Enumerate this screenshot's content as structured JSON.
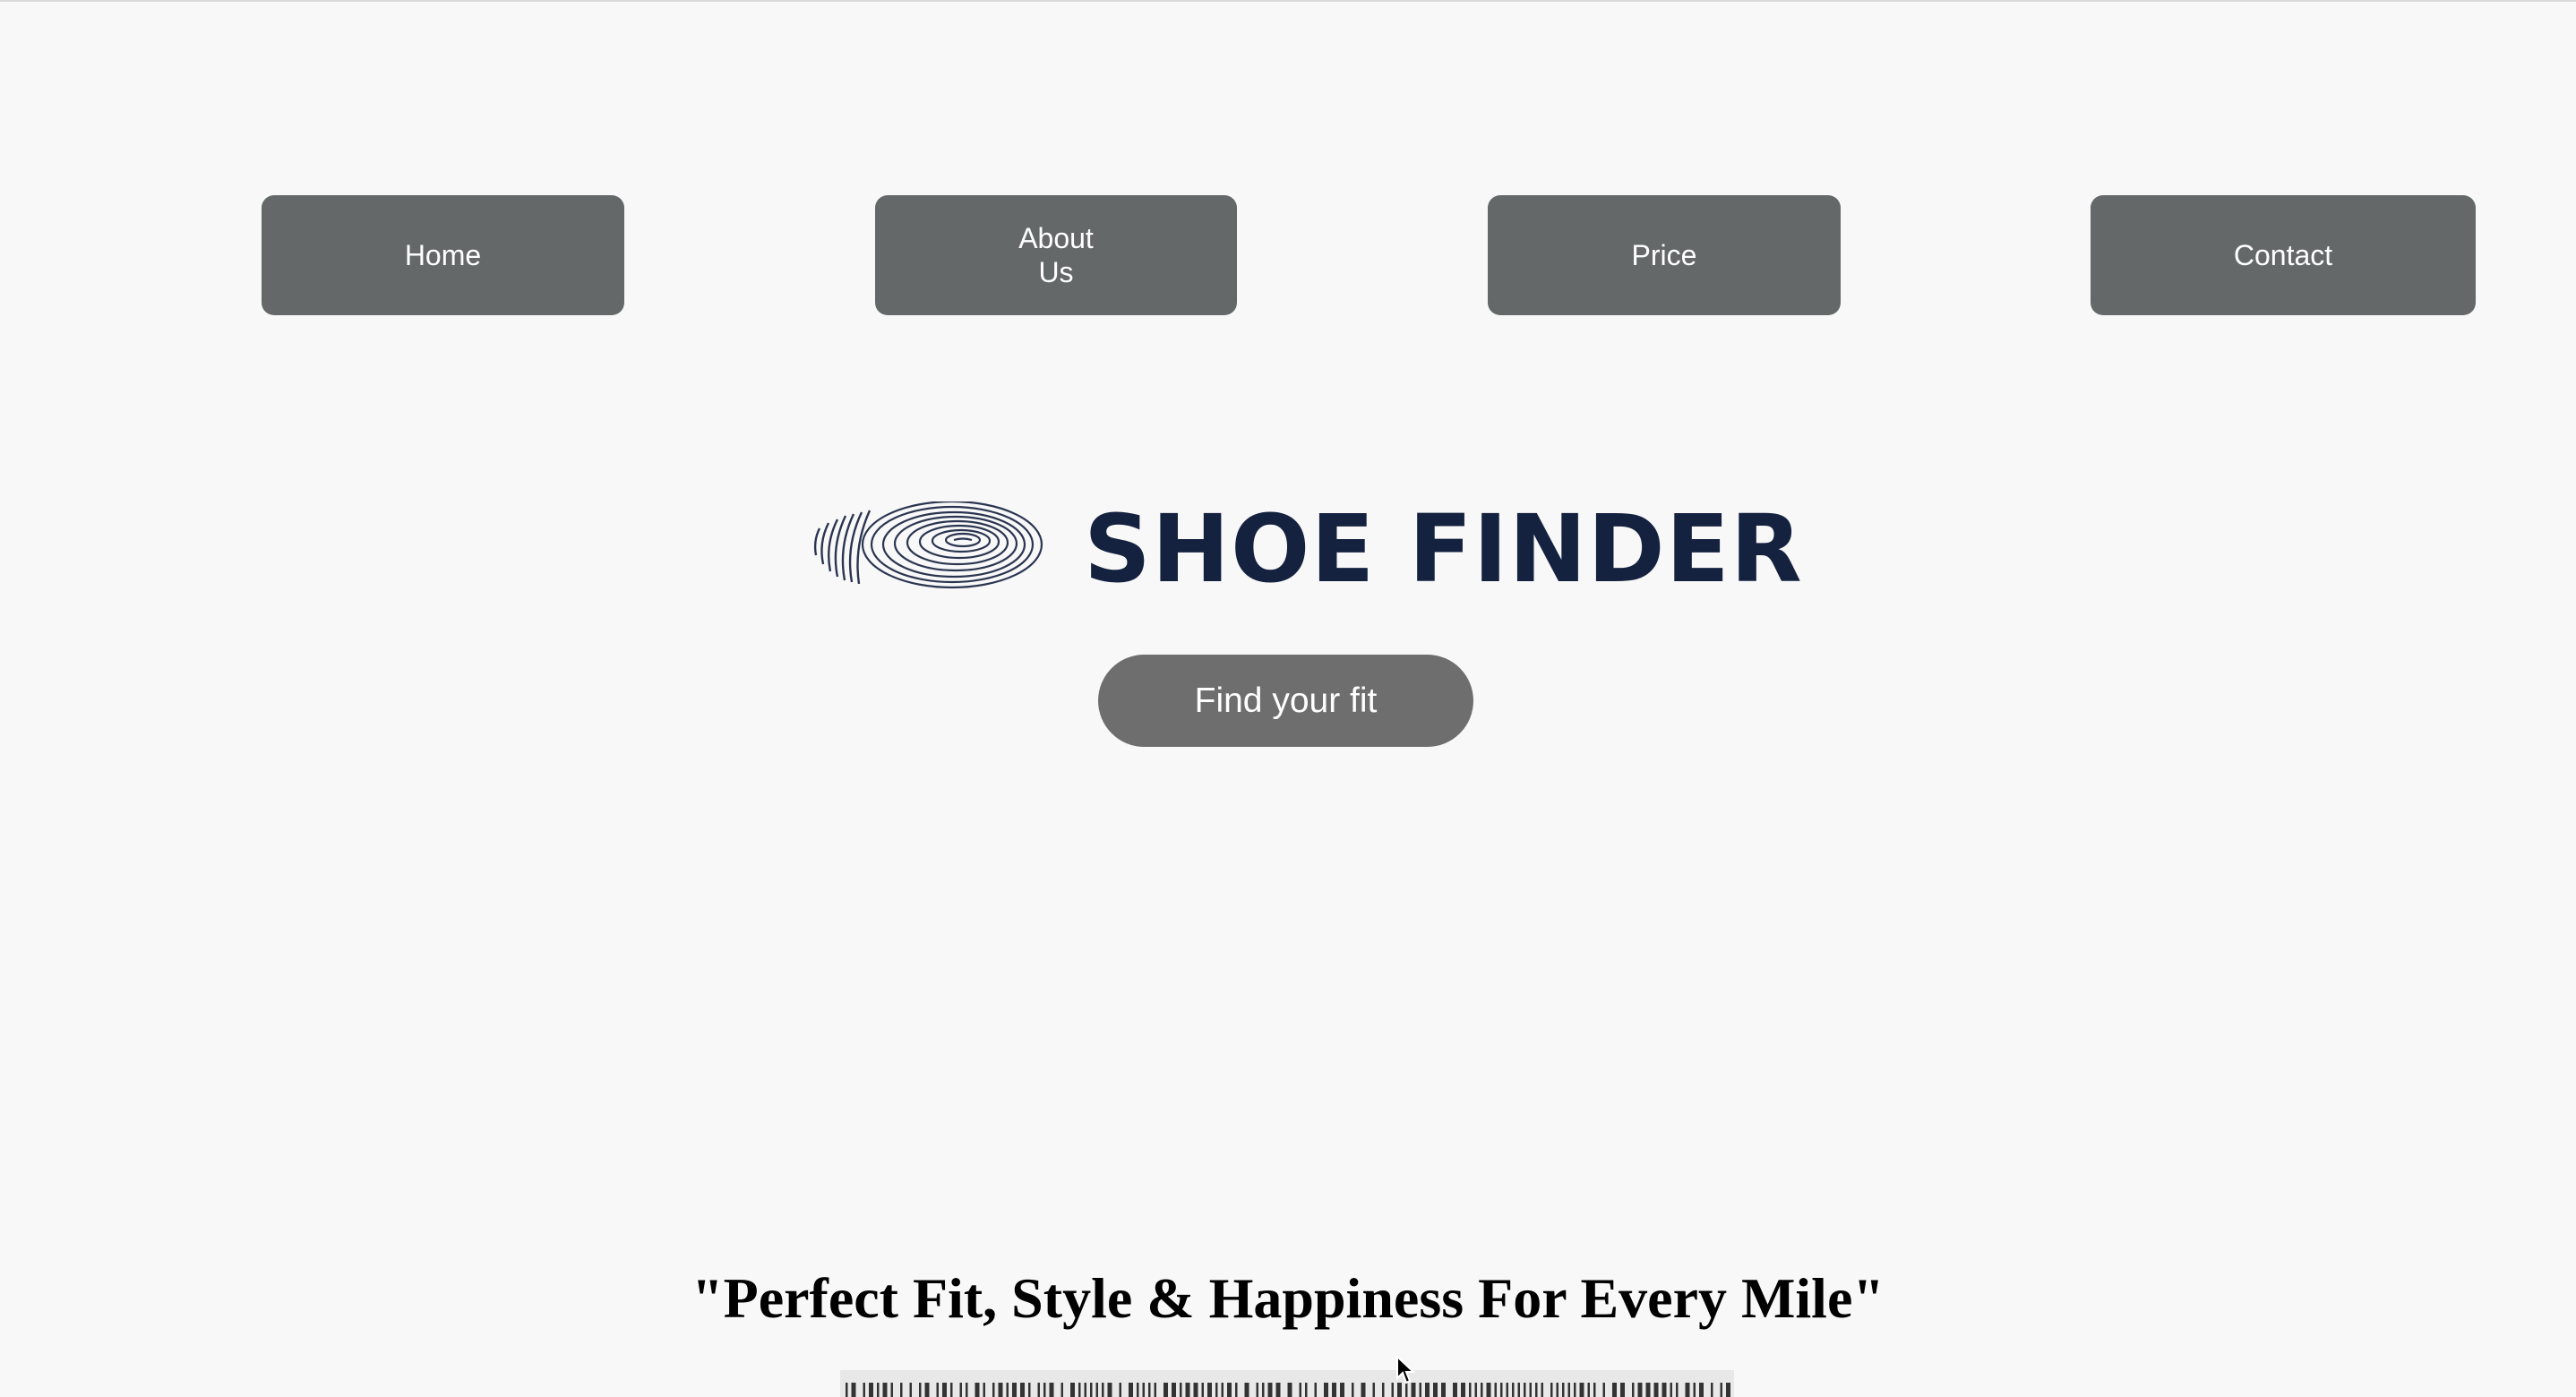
{
  "nav": {
    "items": [
      {
        "label": "Home"
      },
      {
        "label": "About\nUs"
      },
      {
        "label": "Price"
      },
      {
        "label": "Contact"
      }
    ]
  },
  "hero": {
    "logo_icon": "footprint-fingerprint-icon",
    "brand_name": "SHOE FINDER",
    "cta_label": "Find your fit"
  },
  "tagline": "\"Perfect Fit, Style & Happiness For Every Mile\"",
  "colors": {
    "nav_button_bg": "#646869",
    "brand_text": "#15223f",
    "cta_bg": "#6e6e6e",
    "page_bg": "#f8f8f8"
  }
}
